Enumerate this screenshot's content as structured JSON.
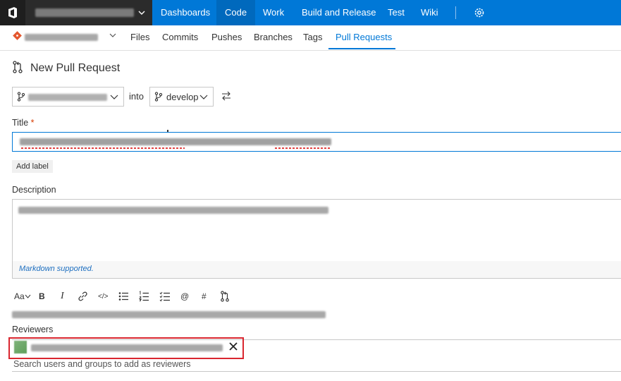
{
  "topnav": {
    "items": [
      "Dashboards",
      "Code",
      "Work",
      "Build and Release",
      "Test",
      "Wiki"
    ],
    "active": "Code"
  },
  "subnav": {
    "items": [
      "Files",
      "Commits",
      "Pushes",
      "Branches",
      "Tags",
      "Pull Requests"
    ],
    "active": "Pull Requests"
  },
  "page": {
    "title": "New Pull Request"
  },
  "branches": {
    "into_label": "into",
    "target": "develop"
  },
  "title_field": {
    "label": "Title",
    "required_mark": "*",
    "add_label": "Add label"
  },
  "description": {
    "label": "Description",
    "markdown_hint": "Markdown supported."
  },
  "toolbar": {
    "items": [
      {
        "label": "Aa",
        "icon": "font-size-icon"
      },
      {
        "label": "B",
        "icon": "bold-icon"
      },
      {
        "label": "I",
        "icon": "italic-icon"
      },
      {
        "label": "",
        "icon": "link-icon"
      },
      {
        "label": "</>",
        "icon": "code-icon"
      },
      {
        "label": "",
        "icon": "bullet-list-icon"
      },
      {
        "label": "",
        "icon": "numbered-list-icon"
      },
      {
        "label": "",
        "icon": "checklist-icon"
      },
      {
        "label": "@",
        "icon": "mention-icon"
      },
      {
        "label": "#",
        "icon": "work-item-icon"
      },
      {
        "label": "",
        "icon": "pull-request-icon"
      }
    ]
  },
  "reviewers": {
    "label": "Reviewers",
    "placeholder": "Search users and groups to add as reviewers"
  },
  "colors": {
    "accent": "#0078d7",
    "highlight": "#d9262f",
    "required": "#d83b01"
  }
}
